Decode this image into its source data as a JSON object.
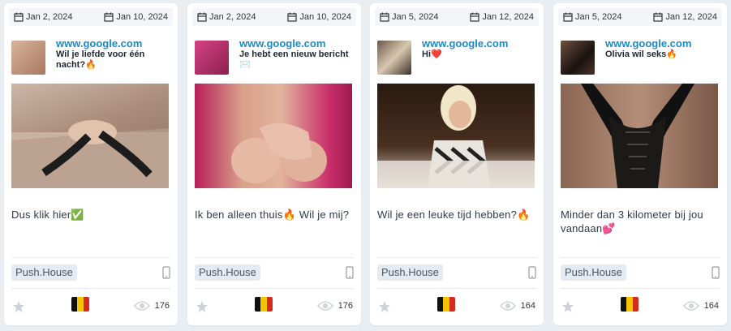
{
  "cards": [
    {
      "start_date": "Jan 2, 2024",
      "end_date": "Jan 10, 2024",
      "domain": "www.google.com",
      "headline": "Wil je liefde voor één nacht?🔥",
      "body": "Dus klik hier✅",
      "network": "Push.House",
      "country_flag": "belgium-flag",
      "views": "176",
      "thumb_color": "#c9a38a",
      "image_color": "#b89b86"
    },
    {
      "start_date": "Jan 2, 2024",
      "end_date": "Jan 10, 2024",
      "domain": "www.google.com",
      "headline": "Je hebt een nieuw bericht✉️",
      "body": "Ik ben alleen thuis🔥 Wil je mij?",
      "network": "Push.House",
      "country_flag": "belgium-flag",
      "views": "176",
      "thumb_color": "#b22d6a",
      "image_color": "#c8336f"
    },
    {
      "start_date": "Jan 5, 2024",
      "end_date": "Jan 12, 2024",
      "domain": "www.google.com",
      "headline": "Hi❤️",
      "body": "Wil je een leuke tijd hebben?🔥",
      "network": "Push.House",
      "country_flag": "belgium-flag",
      "views": "164",
      "thumb_color": "#5c4a3a",
      "image_color": "#3a2a20"
    },
    {
      "start_date": "Jan 5, 2024",
      "end_date": "Jan 12, 2024",
      "domain": "www.google.com",
      "headline": "Olivia wil seks🔥",
      "body": "Minder dan 3 kilometer bij jou vandaan💕",
      "network": "Push.House",
      "country_flag": "belgium-flag",
      "views": "164",
      "thumb_color": "#3b2a24",
      "image_color": "#7a5a4a"
    }
  ],
  "colors": {
    "domain": "#1a8bc7",
    "flag_black": "#111111",
    "flag_yellow": "#f5c400",
    "flag_red": "#d52b1e"
  }
}
